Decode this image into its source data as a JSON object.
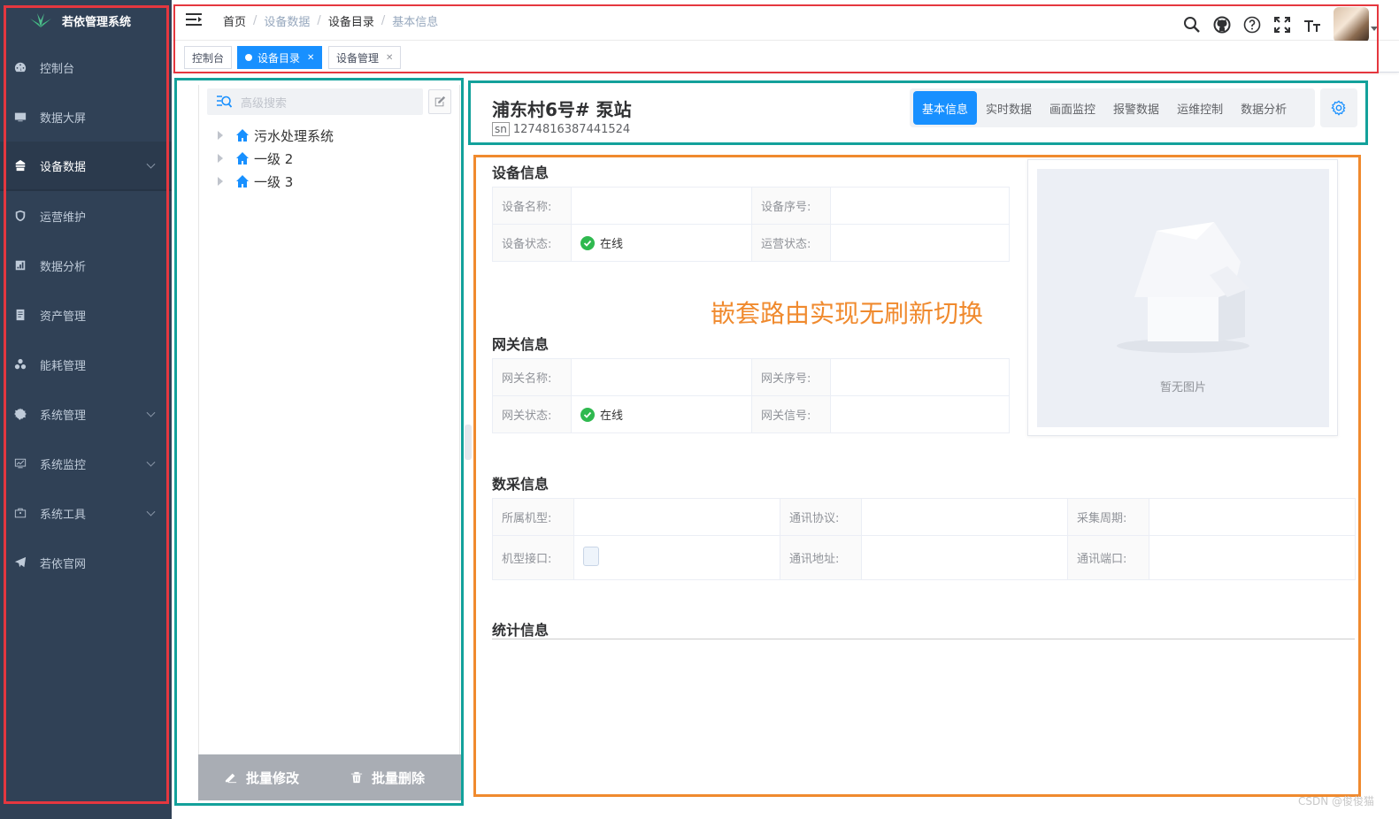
{
  "app": {
    "title": "若依管理系统"
  },
  "sidebar": {
    "items": [
      {
        "label": "控制台"
      },
      {
        "label": "数据大屏"
      },
      {
        "label": "设备数据"
      },
      {
        "label": "运营维护"
      },
      {
        "label": "数据分析"
      },
      {
        "label": "资产管理"
      },
      {
        "label": "能耗管理"
      },
      {
        "label": "系统管理"
      },
      {
        "label": "系统监控"
      },
      {
        "label": "系统工具"
      },
      {
        "label": "若依官网"
      }
    ]
  },
  "breadcrumb": [
    "首页",
    "设备数据",
    "设备目录",
    "基本信息"
  ],
  "tags": [
    {
      "label": "控制台"
    },
    {
      "label": "设备目录"
    },
    {
      "label": "设备管理"
    }
  ],
  "tree": {
    "search_placeholder": "高级搜索",
    "nodes": [
      {
        "label": "污水处理系统"
      },
      {
        "label": "一级 2"
      },
      {
        "label": "一级 3"
      }
    ],
    "batch_edit": "批量修改",
    "batch_delete": "批量删除"
  },
  "device": {
    "name": "浦东村6号# 泵站",
    "sn_label": "sn",
    "sn": "1274816387441524",
    "tabs": [
      "基本信息",
      "实时数据",
      "画面监控",
      "报警数据",
      "运维控制",
      "数据分析"
    ]
  },
  "device_info": {
    "title": "设备信息",
    "name_label": "设备名称:",
    "serial_label": "设备序号:",
    "status_label": "设备状态:",
    "status_value": "在线",
    "op_status_label": "运营状态:"
  },
  "annotation": "嵌套路由实现无刷新切换",
  "gateway_info": {
    "title": "网关信息",
    "name_label": "网关名称:",
    "serial_label": "网关序号:",
    "status_label": "网关状态:",
    "status_value": "在线",
    "signal_label": "网关信号:"
  },
  "image": {
    "caption": "暂无图片"
  },
  "collect_info": {
    "title": "数采信息",
    "model_label": "所属机型:",
    "protocol_label": "通讯协议:",
    "period_label": "采集周期:",
    "iface_label": "机型接口:",
    "address_label": "通讯地址:",
    "port_label": "通讯端口:"
  },
  "stats_info": {
    "title": "统计信息"
  },
  "watermark": "CSDN @俊俊猫",
  "colors": {
    "sidebar_bg": "#304156",
    "primary": "#1890ff",
    "annotation": "#f08a2e",
    "success": "#2fb94f"
  }
}
